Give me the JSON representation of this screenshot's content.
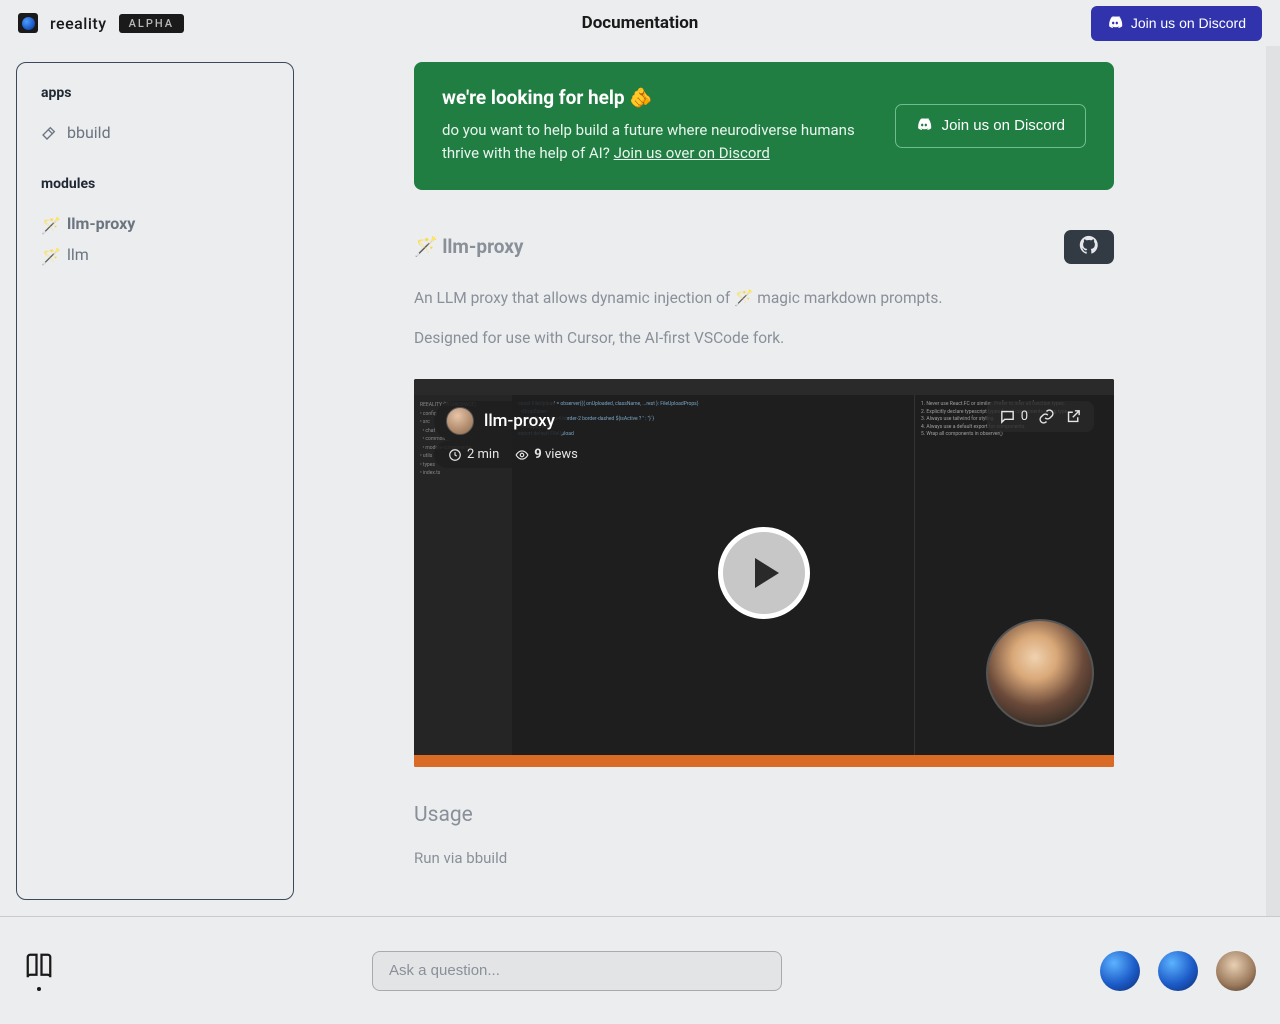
{
  "header": {
    "brand": "reeality",
    "badge": "ALPHA",
    "title": "Documentation",
    "discord_label": "Join us on Discord"
  },
  "sidebar": {
    "sections": [
      {
        "title": "apps",
        "items": [
          {
            "label": "bbuild",
            "icon": "hammer"
          }
        ]
      },
      {
        "title": "modules",
        "items": [
          {
            "label": "llm-proxy",
            "icon": "sparkle",
            "active": true
          },
          {
            "label": "llm",
            "icon": "sparkle"
          }
        ]
      }
    ]
  },
  "cta": {
    "title": "we're looking for help 🫵",
    "body": "do you want to help build a future where neurodiverse humans thrive with the help of AI?",
    "link_text": "Join us over on Discord",
    "button": "Join us on Discord"
  },
  "page": {
    "heading": "🪄 llm-proxy",
    "p1": "An LLM proxy that allows dynamic injection of 🪄 magic markdown prompts.",
    "p2": "Designed for use with Cursor, the AI-first VSCode fork.",
    "usage_heading": "Usage",
    "usage_sub": "Run via bbuild"
  },
  "video": {
    "title": "llm-proxy",
    "duration": "2 min",
    "views_count": "9",
    "views_label": "views",
    "comments": "0"
  },
  "bottom": {
    "ask_placeholder": "Ask a question..."
  },
  "colors": {
    "accent_green": "#217e43",
    "accent_indigo": "#3033ac"
  }
}
